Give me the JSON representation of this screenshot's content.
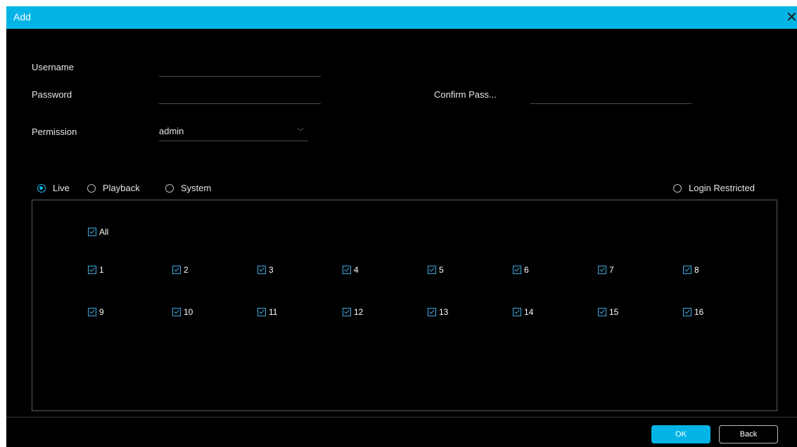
{
  "dialog": {
    "title": "Add"
  },
  "form": {
    "username_label": "Username",
    "username_value": "",
    "password_label": "Password",
    "password_value": "",
    "confirm_label": "Confirm Pass...",
    "confirm_value": "",
    "permission_label": "Permission",
    "permission_value": "admin"
  },
  "tabs": {
    "live": "Live",
    "playback": "Playback",
    "system": "System",
    "selected": "Live",
    "login_restricted": "Login Restricted"
  },
  "channels": {
    "all_label": "All",
    "items": [
      "1",
      "2",
      "3",
      "4",
      "5",
      "6",
      "7",
      "8",
      "9",
      "10",
      "11",
      "12",
      "13",
      "14",
      "15",
      "16"
    ]
  },
  "footer": {
    "ok_label": "OK",
    "back_label": "Back"
  },
  "colors": {
    "accent": "#05b4e6"
  }
}
